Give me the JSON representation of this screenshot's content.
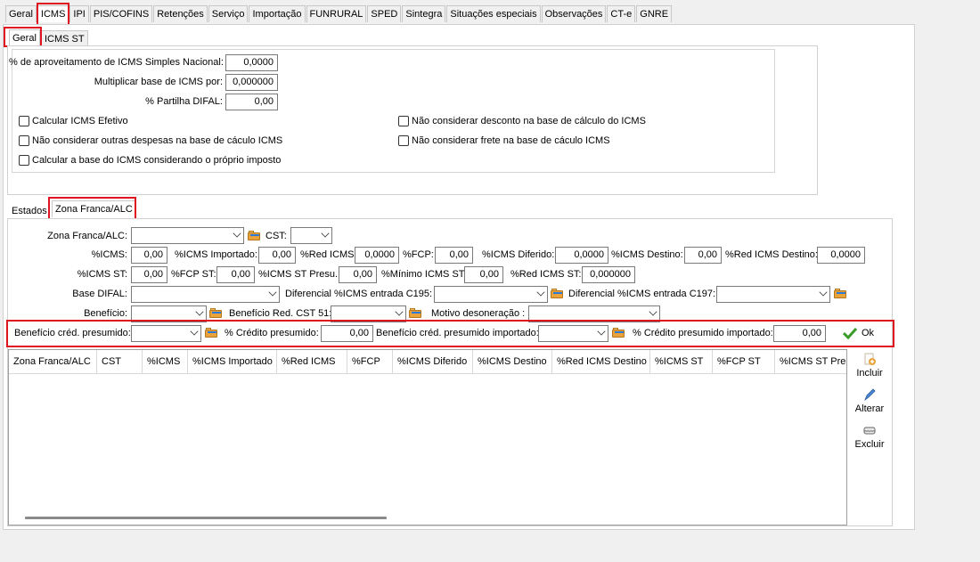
{
  "top_tabs": [
    "Geral",
    "ICMS",
    "IPI",
    "PIS/COFINS",
    "Retenções",
    "Serviço",
    "Importação",
    "FUNRURAL",
    "SPED",
    "Sintegra",
    "Situações especiais",
    "Observações",
    "CT-e",
    "GNRE"
  ],
  "sub_tabs": [
    "Geral",
    "ICMS ST"
  ],
  "geral": {
    "aproveitamento_label": "% de aproveitamento de ICMS Simples Nacional:",
    "aproveitamento_value": "0,0000",
    "multiplicar_label": "Multiplicar base de ICMS por:",
    "multiplicar_value": "0,000000",
    "partilha_label": "% Partilha DIFAL:",
    "partilha_value": "0,00",
    "checkboxes": [
      "Calcular ICMS Efetivo",
      "Não considerar outras despesas na base de cáculo ICMS",
      "Calcular a base do ICMS considerando o próprio imposto",
      "Não considerar desconto na base de cálculo do ICMS",
      "Não considerar frete na base de cáculo ICMS"
    ]
  },
  "lower_tabs": [
    "Estados",
    "Zona Franca/ALC"
  ],
  "zona": {
    "zona_label": "Zona Franca/ALC:",
    "cst_label": "CST:",
    "icms_label": "%ICMS:",
    "icms_value": "0,00",
    "icms_importado_label": "%ICMS Importado:",
    "icms_importado_value": "0,00",
    "red_icms_label": "%Red ICMS:",
    "red_icms_value": "0,0000",
    "fcp_label": "%FCP:",
    "fcp_value": "0,00",
    "icms_diferido_label": "%ICMS Diferido:",
    "icms_diferido_value": "0,0000",
    "icms_destino_label": "%ICMS Destino:",
    "icms_destino_value": "0,00",
    "red_icms_destino_label": "%Red ICMS Destino:",
    "red_icms_destino_value": "0,0000",
    "icms_st_label": "%ICMS ST:",
    "icms_st_value": "0,00",
    "fcp_st_label": "%FCP ST:",
    "fcp_st_value": "0,00",
    "icms_st_presu_label": "%ICMS ST Presu.:",
    "icms_st_presu_value": "0,00",
    "minimo_label": "%Mínimo ICMS ST:",
    "minimo_value": "0,00",
    "red_icms_st_label": "%Red ICMS ST:",
    "red_icms_st_value": "0,000000",
    "base_difal_label": "Base DIFAL:",
    "dif_c195_label": "Diferencial %ICMS entrada C195:",
    "dif_c197_label": "Diferencial %ICMS entrada C197:",
    "beneficio_label": "Benefício:",
    "beneficio_red_label": "Benefício Red. CST 51:",
    "motivo_label": "Motivo desoneração :",
    "cred_presumido_label": "Benefício créd. presumido:",
    "pct_credito_label": "% Crédito presumido:",
    "pct_credito_value": "0,00",
    "cred_importado_label": "Benefício créd. presumido importado:",
    "pct_credito_imp_label": "% Crédito presumido importado:",
    "pct_credito_imp_value": "0,00",
    "ok_label": "Ok"
  },
  "grid_columns": [
    "Zona Franca/ALC",
    "CST",
    "%ICMS",
    "%ICMS Importado",
    "%Red ICMS",
    "%FCP",
    "%ICMS Diferido",
    "%ICMS Destino",
    "%Red ICMS Destino",
    "%ICMS ST",
    "%FCP ST",
    "%ICMS ST Pres"
  ],
  "side_buttons": [
    "Incluir",
    "Alterar",
    "Excluir"
  ]
}
